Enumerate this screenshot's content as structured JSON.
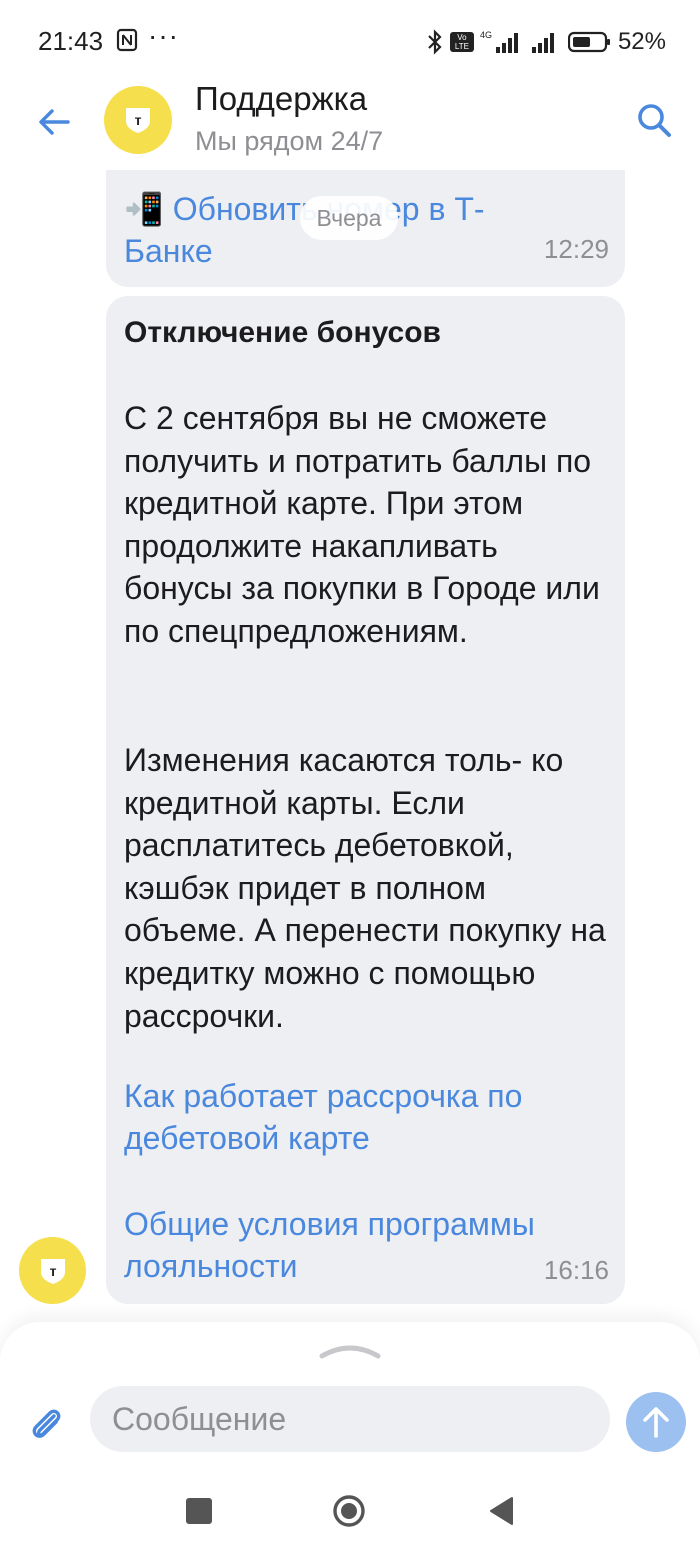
{
  "status_bar": {
    "time": "21:43",
    "more": "···",
    "network": "4G",
    "volte": "Vo LTE",
    "battery": "52%"
  },
  "header": {
    "title": "Поддержка",
    "subtitle": "Мы рядом 24/7",
    "avatar_letter": "т"
  },
  "chat": {
    "date_separator": "Вчера",
    "message1": {
      "icon": "📲",
      "link_text": "Обновить номер в Т-Банке",
      "time": "12:29"
    },
    "message2": {
      "title": "Отключение бонусов",
      "paragraph1": "С 2 сентября вы не сможете получить и потратить баллы по кредитной карте. При этом продолжите накапливать бонусы за покупки в Городе или по спецпредложениям.",
      "paragraph2": "Изменения касаются толь- ко кредитной карты. Если расплатитесь дебетовкой, кэшбэк придет в полном объеме. А перенести покупку на кредитку можно с помощью рассрочки.",
      "link1": "Как работает рассрочка по дебетовой карте",
      "link2": "Общие условия программы лояльности",
      "time": "16:16"
    }
  },
  "composer": {
    "placeholder": "Сообщение"
  },
  "colors": {
    "accent": "#4a88de",
    "brand_yellow": "#f5df4d",
    "bubble": "#eeeff2",
    "send_button": "#9cc1f0"
  }
}
